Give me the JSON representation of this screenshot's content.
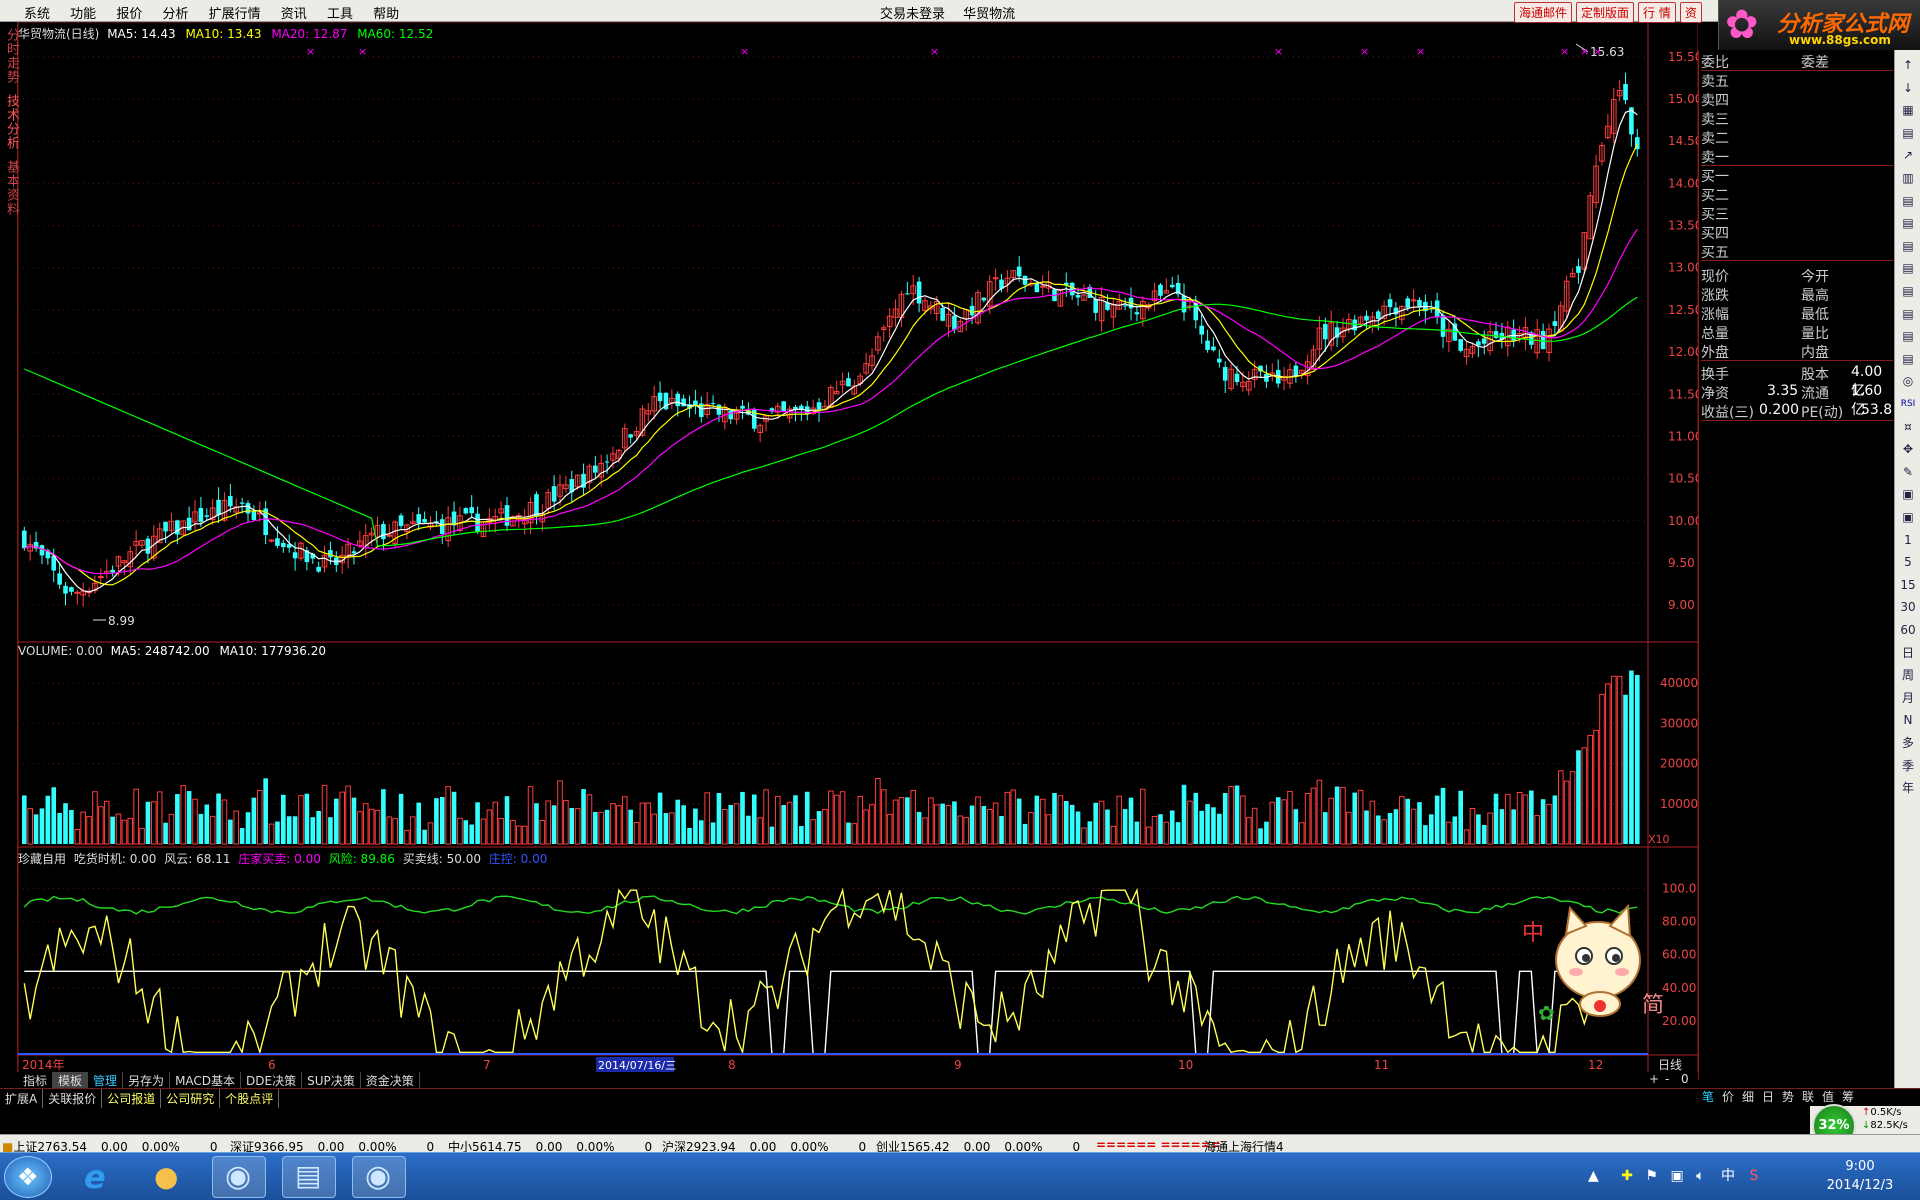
{
  "menu": {
    "items": [
      "系统",
      "功能",
      "报价",
      "分析",
      "扩展行情",
      "资讯",
      "工具",
      "帮助"
    ]
  },
  "status": {
    "login": "交易未登录",
    "stock": "华贸物流"
  },
  "top_buttons": [
    "海通邮件",
    "定制版面",
    "行  情",
    "资"
  ],
  "logo": {
    "title": "分析家公式网",
    "url": "www.88gs.com"
  },
  "left_tabs": [
    "分时走势",
    "技术分析",
    "基本资料"
  ],
  "kline": {
    "name": "华贸物流(日线)",
    "ma5": "MA5: 14.43",
    "ma10": "MA10: 13.43",
    "ma20": "MA20: 12.87",
    "ma60": "MA60: 12.52",
    "high_label": "15.63",
    "low_label": "8.99",
    "yaxis": [
      "15.50",
      "15.00",
      "14.50",
      "14.00",
      "13.50",
      "13.00",
      "12.50",
      "12.00",
      "11.50",
      "11.00",
      "10.50",
      "10.00",
      "9.50",
      "9.00"
    ]
  },
  "volume": {
    "title": "VOLUME: 0.00",
    "ma5": "MA5: 248742.00",
    "ma10": "MA10: 177936.20",
    "yaxis": [
      "40000",
      "30000",
      "20000",
      "10000"
    ],
    "unit": "X10"
  },
  "indicator": {
    "name": "珍藏自用",
    "l1": "吃货时机: 0.00",
    "l2": "风云: 68.11",
    "l3": "庄家买卖: 0.00",
    "l4": "风险: 89.86",
    "l5": "买卖线: 50.00",
    "l6": "庄控: 0.00",
    "yaxis": [
      "100.0",
      "80.00",
      "60.00",
      "40.00",
      "20.00"
    ]
  },
  "xaxis": {
    "labels": [
      "2014年",
      "6",
      "7",
      "8",
      "9",
      "10",
      "11",
      "12"
    ],
    "cursor": "2014/07/16/三",
    "period": "日线"
  },
  "quote": {
    "weibi": "委比",
    "weicha": "委差",
    "asks": [
      "卖五",
      "卖四",
      "卖三",
      "卖二",
      "卖一"
    ],
    "bids": [
      "买一",
      "买二",
      "买三",
      "买四",
      "买五"
    ],
    "rows": [
      [
        "现价",
        "今开"
      ],
      [
        "涨跌",
        "最高"
      ],
      [
        "涨幅",
        "最低"
      ],
      [
        "总量",
        "量比"
      ],
      [
        "外盘",
        "内盘"
      ]
    ],
    "rows2": [
      [
        "换手",
        "",
        "股本",
        "4.00亿"
      ],
      [
        "净资",
        "3.35",
        "流通",
        "1.60亿"
      ],
      [
        "收益(三)",
        "0.200",
        "PE(动)",
        "53.8"
      ]
    ]
  },
  "right_tools": [
    "↑",
    "↓",
    "▦",
    "▤",
    "↗",
    "▥",
    "▤",
    "▤",
    "▤",
    "▤",
    "▤",
    "▤",
    "▤",
    "▤",
    "◎",
    "RSI",
    "¤",
    "✥",
    "✎",
    "▣",
    "▣",
    "1",
    "5",
    "15",
    "30",
    "60",
    "日",
    "周",
    "月",
    "N",
    "多",
    "季",
    "年"
  ],
  "tabbar1": [
    "指标",
    "模板",
    "管理",
    "另存为",
    "MACD基本",
    "DDE决策",
    "SUP决策",
    "资金决策"
  ],
  "tabbar2": [
    "扩展A",
    "关联报价",
    "公司报道",
    "公司研究",
    "个股点评"
  ],
  "periodbar": [
    "笔",
    "价",
    "细",
    "日",
    "势",
    "联",
    "值",
    "筹"
  ],
  "zoom": [
    "+",
    "-",
    "0"
  ],
  "ticker": [
    {
      "name": "上证",
      "v": "2763.54",
      "c": "0.00",
      "p": "0.00%",
      "n": "0"
    },
    {
      "name": "深证",
      "v": "9366.95",
      "c": "0.00",
      "p": "0.00%",
      "n": "0"
    },
    {
      "name": "中小",
      "v": "5614.75",
      "c": "0.00",
      "p": "0.00%",
      "n": "0"
    },
    {
      "name": "沪深",
      "v": "2923.94",
      "c": "0.00",
      "p": "0.00%",
      "n": "0"
    },
    {
      "name": "创业",
      "v": "1565.42",
      "c": "0.00",
      "p": "0.00%",
      "n": "0"
    }
  ],
  "ticker_msg": "====== ======",
  "ticker_src": "海通上海行情4",
  "speed": {
    "pct": "32%",
    "up": "0.5K/s",
    "down": "82.5K/s"
  },
  "clock": {
    "time": "9:00",
    "date": "2014/12/3"
  },
  "tray": {
    "ime": "中"
  },
  "colors": {
    "up": "#ff3c3c",
    "down": "#33ffff",
    "ma5": "#ffffff",
    "ma10": "#ffff00",
    "ma20": "#ff00ff",
    "ma60": "#00ff00"
  }
}
